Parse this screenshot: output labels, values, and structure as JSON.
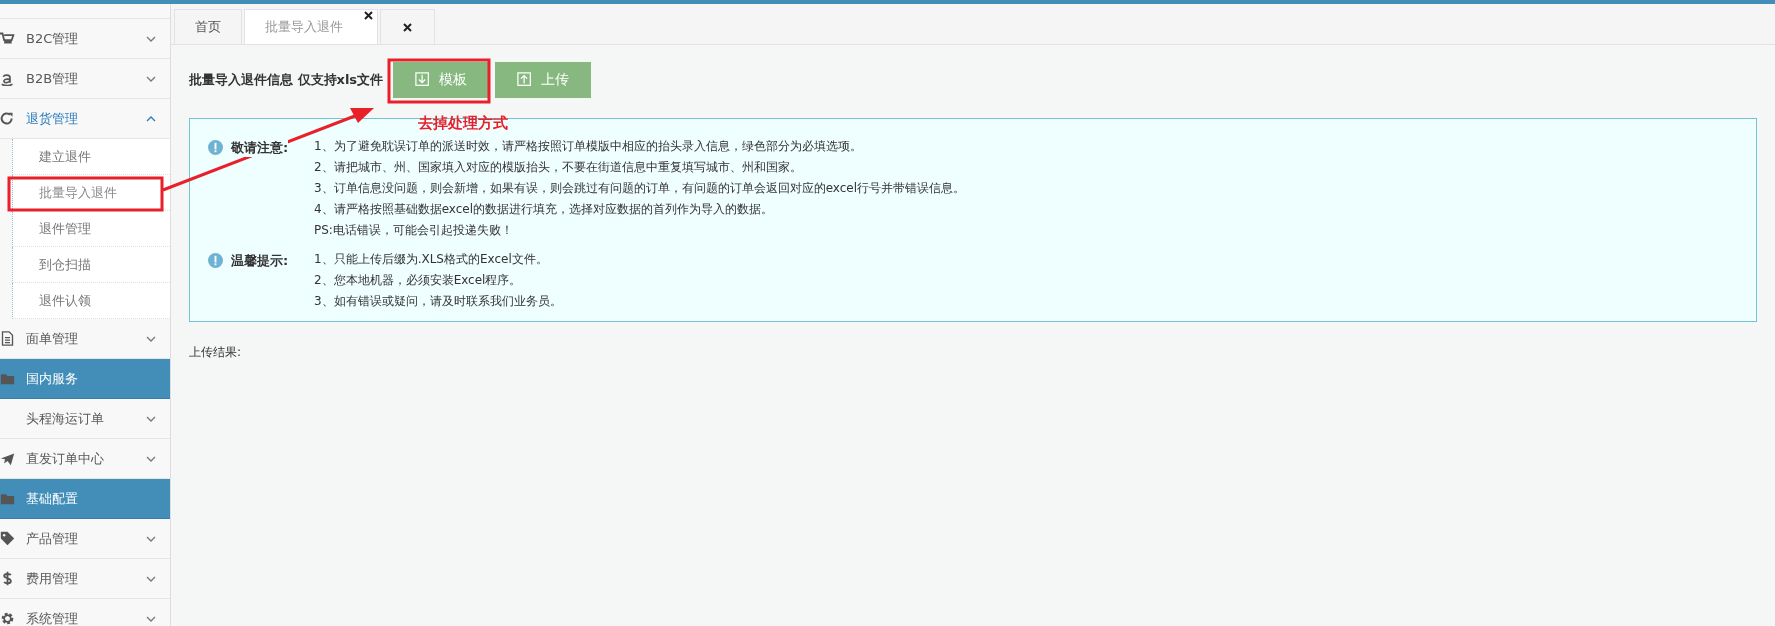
{
  "sidebar": {
    "items": [
      {
        "kind": "menu",
        "label": "B2C管理",
        "expanded": false
      },
      {
        "kind": "menu",
        "label": "B2B管理",
        "expanded": false
      },
      {
        "kind": "menu",
        "label": "退货管理",
        "expanded": true,
        "children": [
          {
            "label": "建立退件",
            "selected": false
          },
          {
            "label": "批量导入退件",
            "selected": true
          },
          {
            "label": "退件管理",
            "selected": false
          },
          {
            "label": "到仓扫描",
            "selected": false
          },
          {
            "label": "退件认领",
            "selected": false
          }
        ]
      },
      {
        "kind": "menu",
        "label": "面单管理",
        "expanded": false
      },
      {
        "kind": "header",
        "label": "国内服务"
      },
      {
        "kind": "menu",
        "label": "头程海运订单",
        "expanded": false
      },
      {
        "kind": "menu",
        "label": "直发订单中心",
        "expanded": false
      },
      {
        "kind": "header",
        "label": "基础配置"
      },
      {
        "kind": "menu",
        "label": "产品管理",
        "expanded": false
      },
      {
        "kind": "menu",
        "label": "费用管理",
        "expanded": false
      },
      {
        "kind": "menu",
        "label": "系统管理",
        "expanded": false
      }
    ]
  },
  "tabs": [
    {
      "kind": "page",
      "label": "首页",
      "selected": false
    },
    {
      "kind": "closable",
      "label": "批量导入退件",
      "selected": true
    },
    {
      "kind": "close"
    }
  ],
  "toolbar": {
    "title": "批量导入退件信息 仅支持xls文件",
    "buttons": [
      {
        "label": "模板"
      },
      {
        "label": "上传"
      }
    ]
  },
  "notices": [
    {
      "title": "敬请注意:",
      "lines": [
        "1、为了避免耽误订单的派送时效，请严格按照订单模版中相应的抬头录入信息，绿色部分为必填选项。",
        "2、请把城市、州、国家填入对应的模版抬头，不要在街道信息中重复填写城市、州和国家。",
        "3、订单信息没问题，则会新增，如果有误，则会跳过有问题的订单，有问题的订单会返回对应的excel行号并带错误信息。",
        "4、请严格按照基础数据excel的数据进行填充，选择对应数据的首列作为导入的数据。",
        "PS:电话错误，可能会引起投递失败！"
      ]
    },
    {
      "title": "温馨提示:",
      "lines": [
        "1、只能上传后缀为.XLS格式的Excel文件。",
        "2、您本地机器，必须安装Excel程序。",
        "3、如有错误或疑问，请及时联系我们业务员。"
      ]
    }
  ],
  "result_label": "上传结果:",
  "annotation": {
    "text": "去掉处理方式"
  }
}
